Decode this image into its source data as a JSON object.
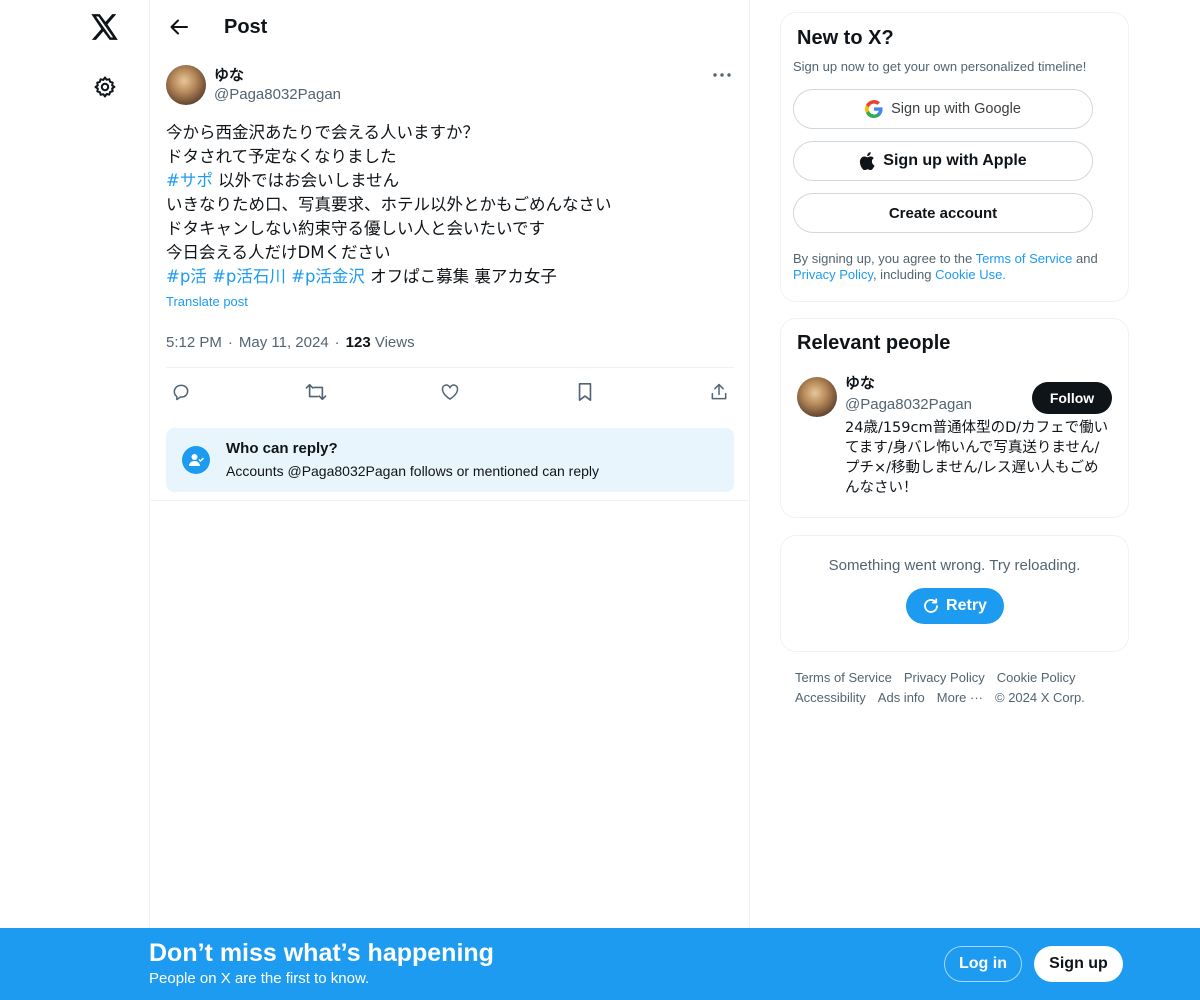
{
  "header": {
    "title": "Post"
  },
  "post": {
    "author_name": "ゆな",
    "author_handle": "@Paga8032Pagan",
    "lines": [
      {
        "text": "今から西金沢あたりで会える人いますか？"
      },
      {
        "text": "ドタされて予定なくなりました"
      },
      {
        "hashtag": "#サポ",
        "text": " 以外ではお会いしません"
      },
      {
        "text": "いきなりため口、写真要求、ホテル以外とかもごめんなさい"
      },
      {
        "text": "ドタキャンしない約束守る優しい人と会いたいです"
      },
      {
        "text": "今日会える人だけDMください"
      }
    ],
    "tags_line": {
      "tag1": "#p活",
      "tag2": "#p活石川",
      "tag3": "#p活金沢",
      "rest": " オフぱこ募集 裏アカ女子"
    },
    "translate_label": "Translate post",
    "time": "5:12 PM",
    "date": "May 11, 2024",
    "views_count": "123",
    "views_label": "Views",
    "reply_title": "Who can reply?",
    "reply_sub": "Accounts @Paga8032Pagan follows or mentioned can reply"
  },
  "sidebar": {
    "newx_title": "New to X?",
    "newx_sub": "Sign up now to get your own personalized timeline!",
    "google_label": "Sign up with Google",
    "apple_label": "Sign up with Apple",
    "create_label": "Create account",
    "legal_pre": "By signing up, you agree to the ",
    "legal_tos": "Terms of Service",
    "legal_and": " and ",
    "legal_privacy": "Privacy Policy",
    "legal_including": ", including ",
    "legal_cookie": "Cookie Use.",
    "relevant_title": "Relevant people",
    "person_name": "ゆな",
    "person_handle": "@Paga8032Pagan",
    "person_bio": "24歳/159cm普通体型のD/カフェで働いてます/身バレ怖いんで写真送りません/プチ×/移動しません/レス遅い人もごめんなさい！",
    "follow_label": "Follow",
    "error_text": "Something went wrong. Try reloading.",
    "retry_label": "Retry",
    "footer": {
      "tos": "Terms of Service",
      "privacy": "Privacy Policy",
      "cookie": "Cookie Policy",
      "accessibility": "Accessibility",
      "ads": "Ads info",
      "more": "More ···",
      "copyright": "© 2024 X Corp."
    }
  },
  "banner": {
    "title": "Don’t miss what’s happening",
    "sub": "People on X are the first to know.",
    "login": "Log in",
    "signup": "Sign up"
  },
  "colors": {
    "accent": "#1d9bf0",
    "text": "#0f1419",
    "muted": "#536471",
    "reply_bg": "#e8f5fd"
  }
}
